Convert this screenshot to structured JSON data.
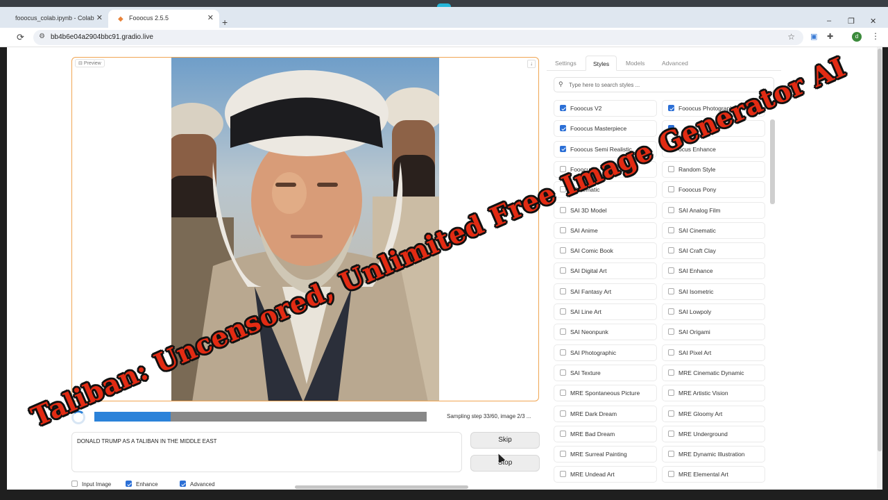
{
  "browser": {
    "tabs": [
      {
        "title": "fooocus_colab.ipynb - Colab",
        "active": false
      },
      {
        "title": "Fooocus 2.5.5",
        "active": true
      }
    ],
    "url": "bb4b6e04a2904bbc91.gradio.live",
    "profile_initial": "d",
    "new_tab_symbol": "+",
    "window_controls": [
      "–",
      "❐",
      "✕"
    ]
  },
  "preview": {
    "label": "Preview"
  },
  "progress": {
    "fraction": 0.23,
    "text": "Sampling step 33/60, image 2/3 ..."
  },
  "prompt": {
    "value": "DONALD TRUMP AS A TALIBAN IN THE MIDDLE EAST"
  },
  "buttons": {
    "skip": "Skip",
    "stop": "Stop"
  },
  "options": [
    {
      "label": "Input Image",
      "checked": false
    },
    {
      "label": "Enhance",
      "checked": true
    },
    {
      "label": "Advanced",
      "checked": true
    }
  ],
  "settings_tabs": [
    {
      "label": "Settings",
      "active": false
    },
    {
      "label": "Styles",
      "active": true
    },
    {
      "label": "Models",
      "active": false
    },
    {
      "label": "Advanced",
      "active": false
    }
  ],
  "style_search": {
    "placeholder": "Type here to search styles ..."
  },
  "styles": [
    {
      "label": "Fooocus V2",
      "checked": true
    },
    {
      "label": "Fooocus Photograph",
      "checked": true
    },
    {
      "label": "Fooocus Masterpiece",
      "checked": true
    },
    {
      "label": "",
      "checked": true
    },
    {
      "label": "Fooocus Semi Realistic",
      "checked": true
    },
    {
      "label": "ocus Enhance",
      "checked": false
    },
    {
      "label": "Fooocus",
      "checked": false
    },
    {
      "label": "Random Style",
      "checked": false
    },
    {
      "label": "t Cinematic",
      "checked": false
    },
    {
      "label": "Fooocus Pony",
      "checked": false
    },
    {
      "label": "SAI 3D Model",
      "checked": false
    },
    {
      "label": "SAI Analog Film",
      "checked": false
    },
    {
      "label": "SAI Anime",
      "checked": false
    },
    {
      "label": "SAI Cinematic",
      "checked": false
    },
    {
      "label": "SAI Comic Book",
      "checked": false
    },
    {
      "label": "SAI Craft Clay",
      "checked": false
    },
    {
      "label": "SAI Digital Art",
      "checked": false
    },
    {
      "label": "SAI Enhance",
      "checked": false
    },
    {
      "label": "SAI Fantasy Art",
      "checked": false
    },
    {
      "label": "SAI Isometric",
      "checked": false
    },
    {
      "label": "SAI Line Art",
      "checked": false
    },
    {
      "label": "SAI Lowpoly",
      "checked": false
    },
    {
      "label": "SAI Neonpunk",
      "checked": false
    },
    {
      "label": "SAI Origami",
      "checked": false
    },
    {
      "label": "SAI Photographic",
      "checked": false
    },
    {
      "label": "SAI Pixel Art",
      "checked": false
    },
    {
      "label": "SAI Texture",
      "checked": false
    },
    {
      "label": "MRE Cinematic Dynamic",
      "checked": false
    },
    {
      "label": "MRE Spontaneous Picture",
      "checked": false
    },
    {
      "label": "MRE Artistic Vision",
      "checked": false
    },
    {
      "label": "MRE Dark Dream",
      "checked": false
    },
    {
      "label": "MRE Gloomy Art",
      "checked": false
    },
    {
      "label": "MRE Bad Dream",
      "checked": false
    },
    {
      "label": "MRE Underground",
      "checked": false
    },
    {
      "label": "MRE Surreal Painting",
      "checked": false
    },
    {
      "label": "MRE Dynamic Illustration",
      "checked": false
    },
    {
      "label": "MRE Undead Art",
      "checked": false
    },
    {
      "label": "MRE Elemental Art",
      "checked": false
    }
  ],
  "overlay": {
    "headline": "Taliban: Uncensored, Unlimited Free Image Generator AI"
  },
  "colors": {
    "accent": "#2b82d9",
    "gallery_border": "#f0a552",
    "headline": "#e22b13"
  }
}
